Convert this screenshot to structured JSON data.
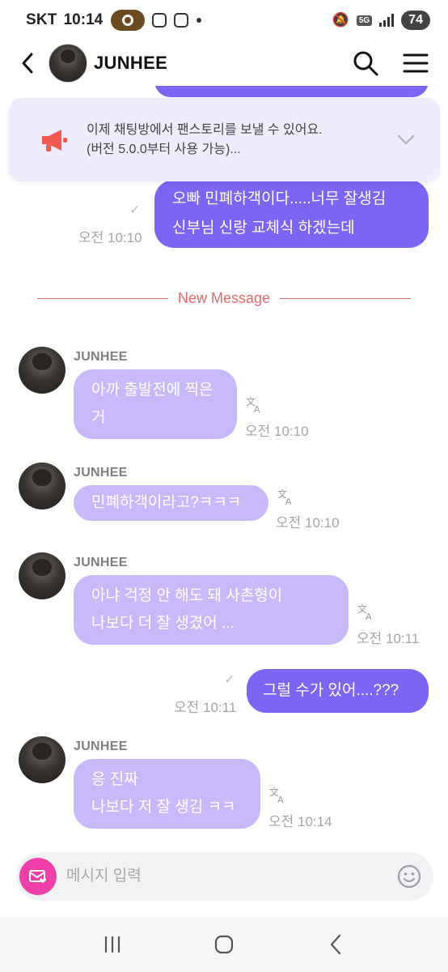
{
  "status_bar": {
    "carrier": "SKT",
    "time": "10:14",
    "network": "5G",
    "battery": "74"
  },
  "header": {
    "title": "JUNHEE",
    "icons": [
      "back-arrow-icon",
      "search-icon",
      "menu-icon"
    ]
  },
  "notice": {
    "line1": "이제 채팅방에서 팬스토리를 보낼 수 있어요.",
    "line2": "(버전 5.0.0부터 사용 가능)...",
    "icon": "megaphone-icon"
  },
  "divider": {
    "label": "New Message"
  },
  "messages": {
    "m1": {
      "line1": "오빠 민폐하객이다.....너무 잘생김",
      "line2": "신부님 신랑 교체식 하겠는데",
      "time": "오전 10:10"
    },
    "m2": {
      "sender": "JUNHEE",
      "line1": "아까 출발전에 찍은",
      "line2": "거",
      "time": "오전 10:10"
    },
    "m3": {
      "sender": "JUNHEE",
      "line1": "민폐하객이라고?ㅋㅋㅋ",
      "time": "오전 10:10"
    },
    "m4": {
      "sender": "JUNHEE",
      "line1": "아냐 걱정 안 해도 돼 사촌형이",
      "line2": "나보다 더 잘 생겼어 ...",
      "time": "오전 10:11"
    },
    "m5": {
      "line1": "그럴 수가 있어....???",
      "time": "오전 10:11"
    },
    "m6": {
      "sender": "JUNHEE",
      "line1": "응 진짜",
      "line2": "나보다 저 잘 생김 ㅋㅋ",
      "time": "오전 10:14"
    }
  },
  "input": {
    "placeholder": "메시지 입력"
  },
  "colors": {
    "outgoing_bubble": "#7c64f5",
    "incoming_bubble": "#c8b9fb",
    "new_message_line": "#e46a6a",
    "letter_button": "#ef3fa8"
  }
}
